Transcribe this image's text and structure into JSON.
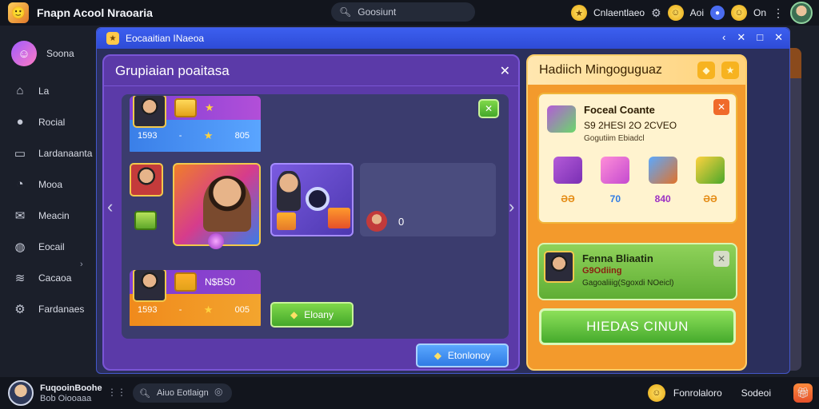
{
  "topbar": {
    "app_title": "Fnapn Acool Nraoaria",
    "search_placeholder": "Goosiunt",
    "currency_label": "Cnlaentlaeo",
    "coin_label": "Aoi",
    "status_label": "On"
  },
  "sidebar": {
    "items": [
      {
        "label": "Soona",
        "icon": "profile-icon"
      },
      {
        "label": "La",
        "icon": "home-icon"
      },
      {
        "label": "Rocial",
        "icon": "chat-icon"
      },
      {
        "label": "Lardanaanta",
        "icon": "leaderboard-icon"
      },
      {
        "label": "Mooa",
        "icon": "compass-icon"
      },
      {
        "label": "Meacin",
        "icon": "message-icon"
      },
      {
        "label": "Eocail",
        "icon": "globe-icon"
      },
      {
        "label": "Cacaoa",
        "icon": "layers-icon"
      },
      {
        "label": "Fardanaes",
        "icon": "gear-icon"
      }
    ]
  },
  "window": {
    "title": "Eocaaitian INaeoa"
  },
  "group_panel": {
    "title": "Grupiaian poaitasa",
    "card1": {
      "left": "1593",
      "mid": "-",
      "right": "805"
    },
    "card2": {
      "header": "N$BS0",
      "left": "1593",
      "mid": "-",
      "right": "005"
    },
    "small_count": "0",
    "action_button": "Eloany",
    "bottom_button": "Etonlonoy"
  },
  "reward_panel": {
    "title": "Hadiich Mingoguguaz",
    "reward_title": "Foceal Coante",
    "reward_date": "S9 2HESI 2O 2CVEO",
    "reward_sub": "Gogutiim Ebiadcl",
    "items": [
      {
        "value": "ƏƏ"
      },
      {
        "value": "70"
      },
      {
        "value": "840"
      },
      {
        "value": "ƏƏ"
      }
    ],
    "friend_name": "Fenna Bliaatin",
    "friend_status": "G9Odiing",
    "friend_text": "Gagoaliiig(Sgoxdi NOeicl)",
    "claim_button": "HIEDAS CINUN"
  },
  "bottombar": {
    "user_name": "FuqooinBoohe",
    "user_sub": "Bob Oiooaaa",
    "search_placeholder": "Aiuo Eotlaign",
    "friend_label": "Fonrolaloro",
    "settings_label": "Sodeoi"
  }
}
